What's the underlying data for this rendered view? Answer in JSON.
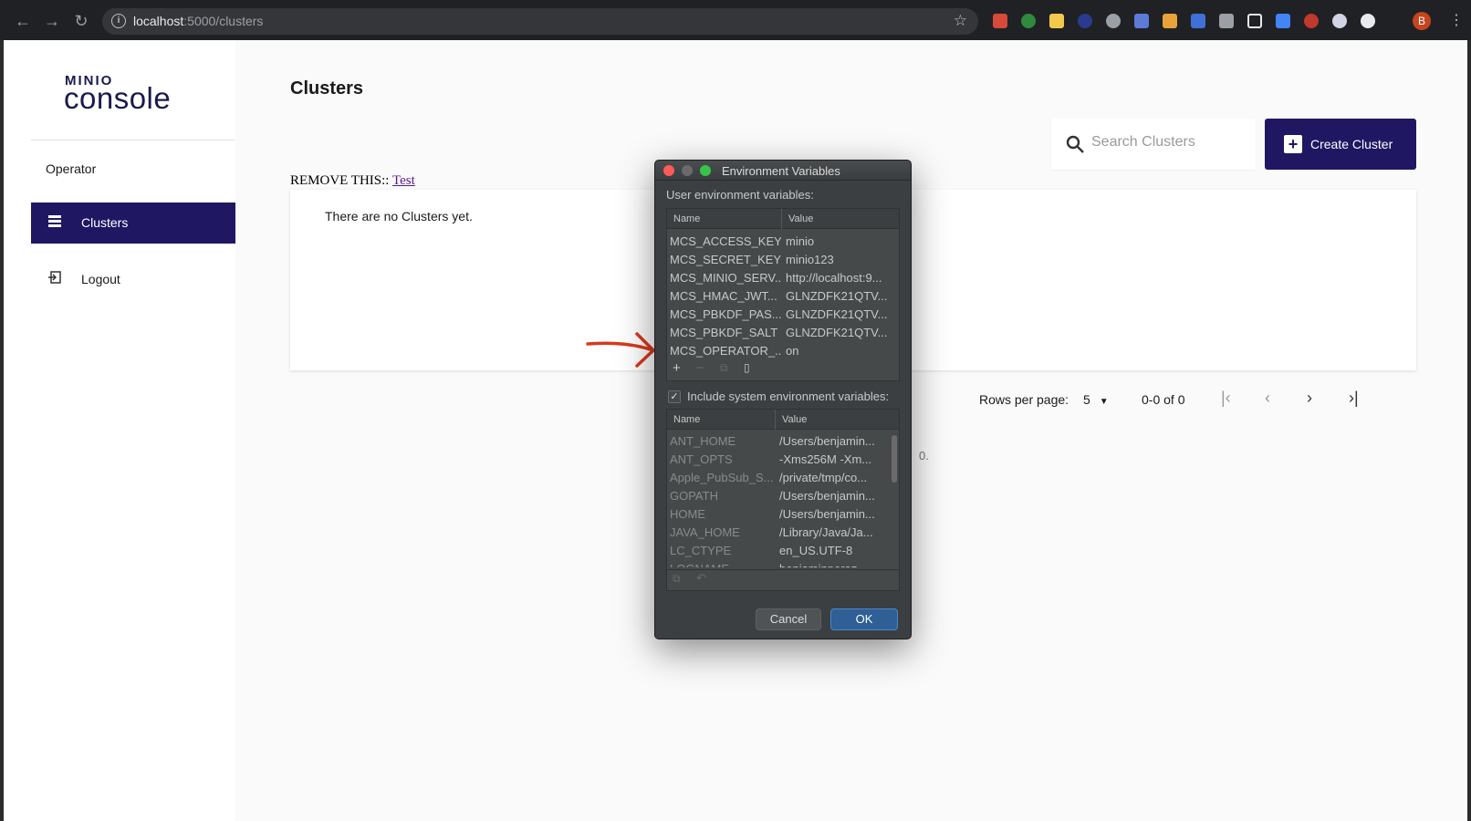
{
  "browser": {
    "url_host": "localhost",
    "url_path": ":5000/clusters",
    "profile_initial": "B"
  },
  "sidebar": {
    "logo_top": "MINIO",
    "logo_bottom": "console",
    "items": [
      {
        "label": "Operator"
      },
      {
        "label": "Clusters"
      },
      {
        "label": "Logout"
      }
    ]
  },
  "main": {
    "title": "Clusters",
    "search_placeholder": "Search Clusters",
    "create_label": "Create Cluster",
    "remove_prefix": "REMOVE THIS:: ",
    "remove_link": "Test",
    "empty_text": "There are no Clusters yet.",
    "rows_per_page_label": "Rows per page:",
    "rows_per_page_value": "5",
    "range_text": "0-0 of 0",
    "stray_text": "0."
  },
  "dialog": {
    "title": "Environment Variables",
    "user_label": "User environment variables:",
    "col_name": "Name",
    "col_value": "Value",
    "user_vars": [
      {
        "name": "MCS_ACCESS_KEY",
        "value": "minio"
      },
      {
        "name": "MCS_SECRET_KEY",
        "value": "minio123"
      },
      {
        "name": "MCS_MINIO_SERV...",
        "value": "http://localhost:9..."
      },
      {
        "name": "MCS_HMAC_JWT...",
        "value": "GLNZDFK21QTV..."
      },
      {
        "name": "MCS_PBKDF_PAS...",
        "value": "GLNZDFK21QTV..."
      },
      {
        "name": "MCS_PBKDF_SALT",
        "value": "GLNZDFK21QTV..."
      },
      {
        "name": "MCS_OPERATOR_...",
        "value": "on"
      }
    ],
    "include_system_label": "Include system environment variables:",
    "system_vars": [
      {
        "name": "ANT_HOME",
        "value": "/Users/benjamin..."
      },
      {
        "name": "ANT_OPTS",
        "value": "-Xms256M -Xm..."
      },
      {
        "name": "Apple_PubSub_S...",
        "value": "/private/tmp/co..."
      },
      {
        "name": "GOPATH",
        "value": "/Users/benjamin..."
      },
      {
        "name": "HOME",
        "value": "/Users/benjamin..."
      },
      {
        "name": "JAVA_HOME",
        "value": "/Library/Java/Ja..."
      },
      {
        "name": "LC_CTYPE",
        "value": "en_US.UTF-8"
      },
      {
        "name": "LOGNAME",
        "value": "benjaminperez"
      }
    ],
    "cancel_label": "Cancel",
    "ok_label": "OK"
  },
  "colors": {
    "brand": "#201763",
    "dialog_bg": "#3c3f41",
    "ok_button": "#2f5f96",
    "annotation_arrow": "#d9391e"
  }
}
